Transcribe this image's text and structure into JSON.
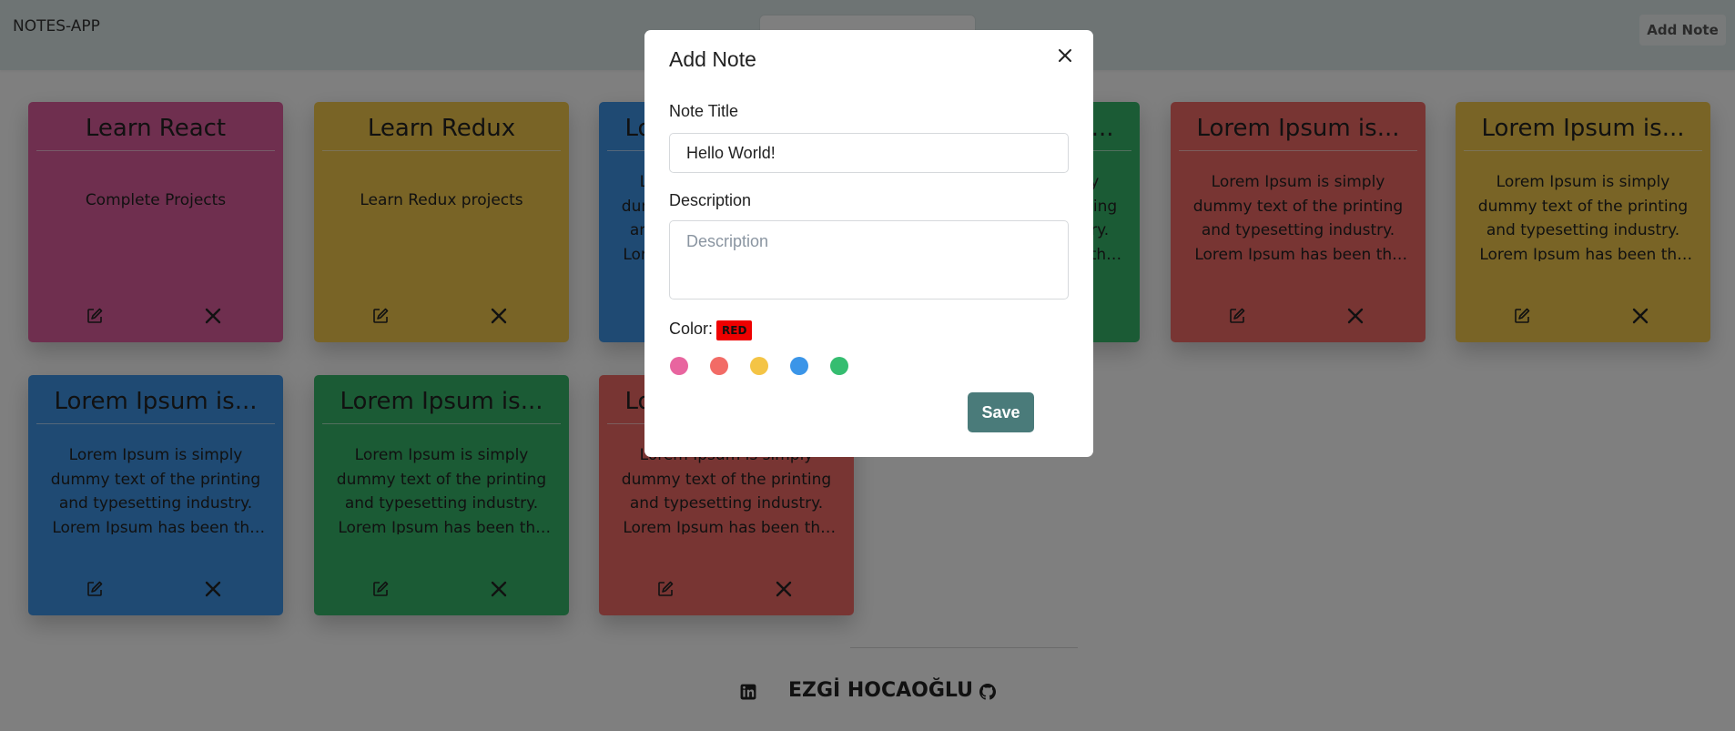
{
  "navbar": {
    "brand": "NOTES-APP",
    "add_note_label": "Add Note"
  },
  "cards": [
    {
      "title": "Learn React",
      "desc": "Complete Projects",
      "color": "#de5e9e"
    },
    {
      "title": "Learn Redux",
      "desc": "Learn Redux projects",
      "color": "#f2c94c"
    },
    {
      "title": "Lorem Ipsum is...",
      "desc": "Lorem Ipsum is simply dummy text of the printing and typesetting industry. Lorem Ipsum has been the industry's...",
      "color": "#3e94e6"
    },
    {
      "title": "Lorem Ipsum is...",
      "desc": "Lorem Ipsum is simply dummy text of the printing and typesetting industry. Lorem Ipsum has been the industry's...",
      "color": "#37b76a"
    },
    {
      "title": "Lorem Ipsum is...",
      "desc": "Lorem Ipsum is simply dummy text of the printing and typesetting industry. Lorem Ipsum has been the industry's...",
      "color": "#f06a66"
    },
    {
      "title": "Lorem Ipsum is...",
      "desc": "Lorem Ipsum is simply dummy text of the printing and typesetting industry. Lorem Ipsum has been the industry's...",
      "color": "#f2c94c"
    },
    {
      "title": "Lorem Ipsum is...",
      "desc": "Lorem Ipsum is simply dummy text of the printing and typesetting industry. Lorem Ipsum has been the industry's...",
      "color": "#3e94e6"
    },
    {
      "title": "Lorem Ipsum is...",
      "desc": "Lorem Ipsum is simply dummy text of the printing and typesetting industry. Lorem Ipsum has been the industry's...",
      "color": "#37b76a"
    },
    {
      "title": "Lorem Ipsum is...",
      "desc": "Lorem Ipsum is simply dummy text of the printing and typesetting industry. Lorem Ipsum has been the industry's...",
      "color": "#f06a66"
    }
  ],
  "modal": {
    "title": "Add Note",
    "note_title_label": "Note Title",
    "note_title_value": "Hello World!",
    "description_label": "Description",
    "description_placeholder": "Description",
    "color_label": "Color:",
    "selected_color": "RED",
    "colors": [
      "#e8659f",
      "#f26b66",
      "#f4c445",
      "#3b95e8",
      "#35bd70"
    ],
    "save_label": "Save"
  },
  "footer": {
    "author": "EZGİ HOCAOĞLU"
  }
}
